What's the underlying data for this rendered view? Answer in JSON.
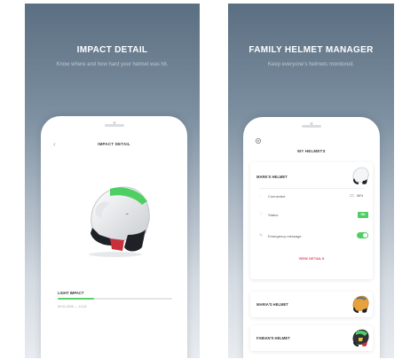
{
  "left": {
    "title": "IMPACT DETAIL",
    "subtitle": "Know where and how hard your helmet was hit.",
    "screen": {
      "title": "IMPACT DETAIL",
      "impact_label": "LIGHT IMPACT",
      "impact_level": 0.32,
      "impact_date": "09.01.2020 — 14:22"
    }
  },
  "right": {
    "title": "FAMILY HELMET MANAGER",
    "subtitle": "Keep everyone's helmets monitored.",
    "screen": {
      "title": "MY HELMETS",
      "primary": {
        "name": "MARK'S HELMET",
        "connected_label": "Connected",
        "battery": "88%",
        "status_label": "Status",
        "status_value": "OK",
        "emergency_label": "Emergency message",
        "link": "VIEW DETAILS"
      },
      "others": [
        {
          "name": "MARIA'S HELMET"
        },
        {
          "name": "FABIAN'S HELMET"
        }
      ]
    }
  },
  "colors": {
    "accent": "#4fcf63",
    "link": "#e04450",
    "backdrop": "#5b6f82"
  }
}
